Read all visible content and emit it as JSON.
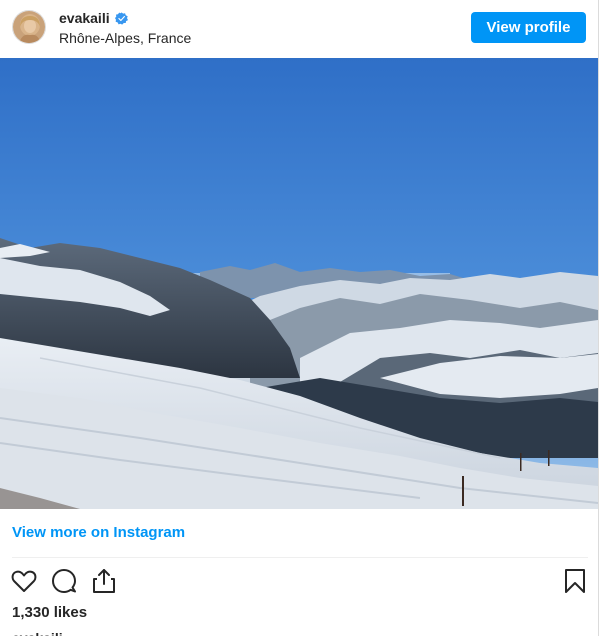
{
  "header": {
    "username": "evakaili",
    "location": "Rhône-Alpes, France",
    "view_profile_label": "View profile"
  },
  "post": {
    "image_subject": "snowy alpine ski slopes under clear blue sky"
  },
  "footer": {
    "view_more_label": "View more on Instagram",
    "likes_text": "1,330 likes",
    "caption_username": "evakaili"
  },
  "icons": {
    "avatar": "avatar",
    "verified": "verified-badge-icon",
    "like": "heart-icon",
    "comment": "comment-icon",
    "share": "share-icon",
    "save": "bookmark-icon"
  },
  "colors": {
    "accent": "#0095f6",
    "text": "#262626",
    "divider": "#efefef"
  }
}
